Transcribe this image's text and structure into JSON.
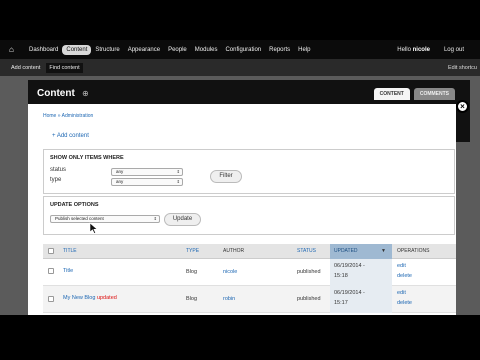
{
  "toolbar": {
    "items": [
      "Dashboard",
      "Content",
      "Structure",
      "Appearance",
      "People",
      "Modules",
      "Configuration",
      "Reports",
      "Help"
    ],
    "active_index": 1,
    "hello_prefix": "Hello",
    "user": "nicole",
    "logout": "Log out"
  },
  "shortcuts": {
    "items": [
      "Add content",
      "Find content"
    ],
    "edit": "Edit shortcu"
  },
  "page": {
    "title": "Content",
    "tabs": [
      "CONTENT",
      "COMMENTS"
    ]
  },
  "breadcrumb": "Home » Administration",
  "add_content": "Add content",
  "filter": {
    "legend": "SHOW ONLY ITEMS WHERE",
    "status_label": "status",
    "status_value": "any",
    "type_label": "type",
    "type_value": "any",
    "button": "Filter"
  },
  "update": {
    "legend": "UPDATE OPTIONS",
    "selected": "Publish selected content",
    "button": "Update"
  },
  "table": {
    "headers": [
      "TITLE",
      "TYPE",
      "AUTHOR",
      "STATUS",
      "UPDATED",
      "OPERATIONS"
    ],
    "rows": [
      {
        "title": "Title",
        "updated_flag": "",
        "type": "Blog",
        "author": "nicole",
        "status": "published",
        "date": "06/19/2014 -",
        "time": "15:18",
        "op1": "edit",
        "op2": "delete"
      },
      {
        "title": "My New Blog",
        "updated_flag": "updated",
        "type": "Blog",
        "author": "robin",
        "status": "published",
        "date": "06/19/2014 -",
        "time": "15:17",
        "op1": "edit",
        "op2": "delete"
      }
    ]
  },
  "colors": {
    "link": "#1d67b3",
    "sorted_header": "#9fb9d2",
    "updated_flag": "#dd1111"
  }
}
